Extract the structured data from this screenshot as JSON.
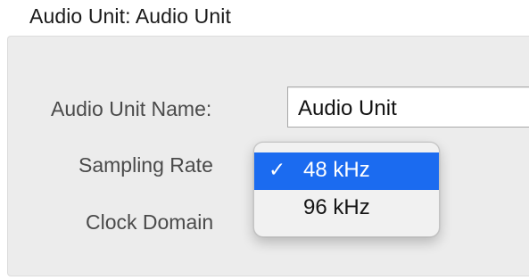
{
  "section": {
    "title": "Audio Unit: Audio Unit"
  },
  "form": {
    "name_label": "Audio Unit Name:",
    "name_value": "Audio Unit",
    "rate_label": "Sampling Rate",
    "clock_label": "Clock Domain"
  },
  "sampling_rate_menu": {
    "items": [
      {
        "label": "48 kHz",
        "checked": true,
        "check_glyph": "✓"
      },
      {
        "label": "96 kHz",
        "checked": false,
        "check_glyph": ""
      }
    ]
  },
  "colors": {
    "selection": "#1b6bf0",
    "panel_background": "#ececec"
  },
  "icons": {
    "selected_marker": "checkmark-icon"
  }
}
